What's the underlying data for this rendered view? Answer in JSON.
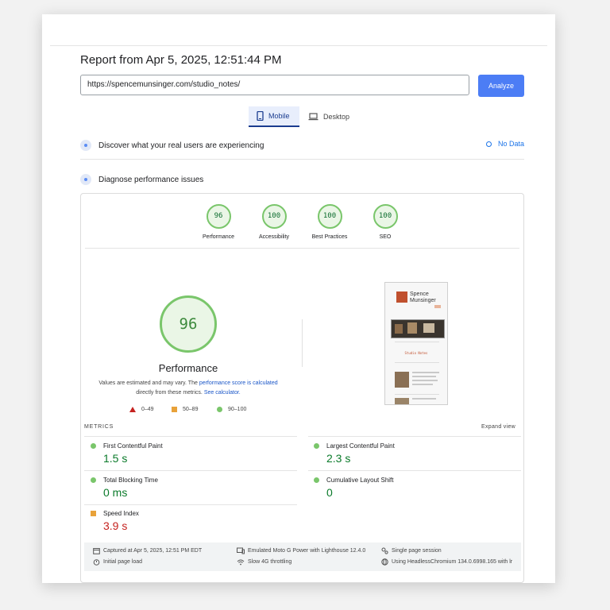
{
  "report": {
    "title": "Report from Apr 5, 2025, 12:51:44 PM",
    "url": "https://spencemunsinger.com/studio_notes/",
    "analyze_label": "Analyze"
  },
  "tabs": [
    {
      "label": "Mobile",
      "icon": "phone-icon",
      "active": true
    },
    {
      "label": "Desktop",
      "icon": "laptop-icon",
      "active": false
    }
  ],
  "field_data": {
    "heading": "Discover what your real users are experiencing",
    "status": "No Data"
  },
  "diagnose": {
    "heading": "Diagnose performance issues"
  },
  "scores": [
    {
      "value": "96",
      "label": "Performance"
    },
    {
      "value": "100",
      "label": "Accessibility"
    },
    {
      "value": "100",
      "label": "Best Practices"
    },
    {
      "value": "100",
      "label": "SEO"
    }
  ],
  "performance": {
    "score": "96",
    "title": "Performance",
    "note_prefix": "Values are estimated and may vary. The ",
    "note_link": "performance score is calculated",
    "note_mid": " directly from these metrics. ",
    "note_link2": "See calculator.",
    "legend": [
      {
        "range": "0–49",
        "shape": "triangle",
        "color": "#c5221f"
      },
      {
        "range": "50–89",
        "shape": "square",
        "color": "#e8a23a"
      },
      {
        "range": "90–100",
        "shape": "circle",
        "color": "#7ac66b"
      }
    ]
  },
  "screenshot": {
    "logo_text_1": "Spence",
    "logo_text_2": "Munsinger",
    "section_title": "Studio Notes"
  },
  "metrics": {
    "label": "METRICS",
    "expand_label": "Expand view",
    "items": [
      {
        "name": "First Contentful Paint",
        "value": "1.5 s",
        "rating": "good"
      },
      {
        "name": "Largest Contentful Paint",
        "value": "2.3 s",
        "rating": "good"
      },
      {
        "name": "Total Blocking Time",
        "value": "0 ms",
        "rating": "good"
      },
      {
        "name": "Cumulative Layout Shift",
        "value": "0",
        "rating": "good"
      },
      {
        "name": "Speed Index",
        "value": "3.9 s",
        "rating": "average"
      }
    ]
  },
  "footer": {
    "captured": "Captured at Apr 5, 2025, 12:51 PM EDT",
    "page_load": "Initial page load",
    "device": "Emulated Moto G Power with Lighthouse 12.4.0",
    "throttling": "Slow 4G throttling",
    "session": "Single page session",
    "browser": "Using HeadlessChromium 134.0.6998.165 with lr"
  },
  "colors": {
    "accent": "#4c7df5",
    "pass": "#7ac66b",
    "average": "#e8a23a",
    "fail": "#c5221f"
  }
}
